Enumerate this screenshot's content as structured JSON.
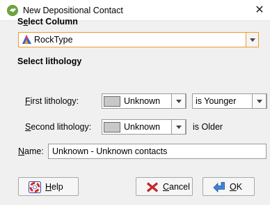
{
  "window": {
    "title": "New Depositional Contact",
    "close_glyph": "✕"
  },
  "select_column": {
    "heading": "Select Column",
    "heading_accel_index": 1,
    "value": "RockType",
    "icon": "rocktype-column-icon"
  },
  "select_lithology": {
    "heading": "Select lithology",
    "first": {
      "label": "First lithology:",
      "value": "Unknown",
      "relation": "is Younger"
    },
    "second": {
      "label": "Second lithology:",
      "value": "Unknown",
      "relation_text": "is Older"
    }
  },
  "name": {
    "label": "Name:",
    "value": "Unknown - Unknown contacts"
  },
  "buttons": {
    "help": "Help",
    "cancel": "Cancel",
    "ok": "OK"
  },
  "colors": {
    "accent_border": "#f09a2a",
    "app_icon": "#6da33f",
    "swatch": "#c8c8c8"
  }
}
